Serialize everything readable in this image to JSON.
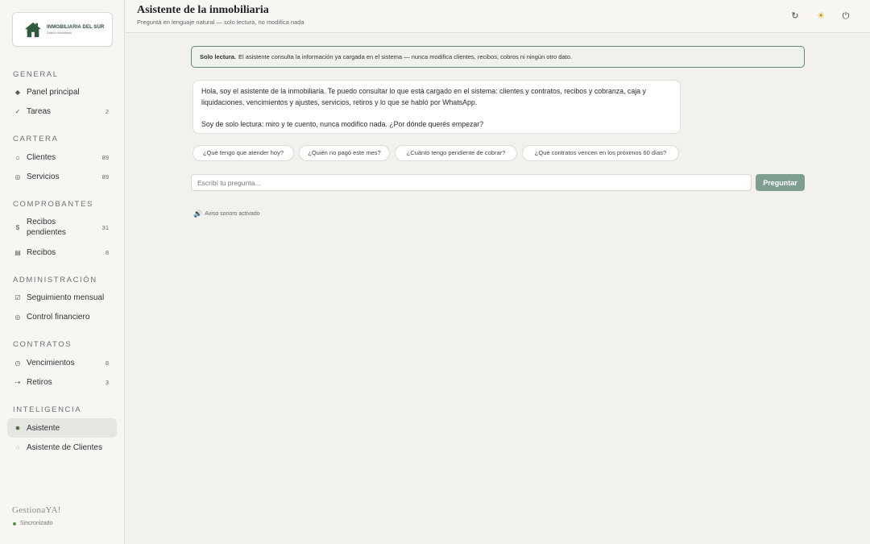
{
  "sidebar": {
    "logo_title": "INMOBILIARIA DEL SUR",
    "logo_subtitle": "Gestión inmobiliaria",
    "sections": {
      "general": "General",
      "cartera": "Cartera",
      "comprobantes": "Comprobantes",
      "administracion": "Administración",
      "contratos": "Contratos",
      "inteligencia": "Inteligencia"
    },
    "items": {
      "panel": {
        "label": "Panel principal",
        "icon": "◆"
      },
      "tareas": {
        "label": "Tareas",
        "icon": "✓",
        "count": "2"
      },
      "clientes": {
        "label": "Clientes",
        "icon": "⌂",
        "count": "89"
      },
      "servicios": {
        "label": "Servicios",
        "icon": "◎",
        "count": "89"
      },
      "recibos_pendientes": {
        "label": "Recibos pendientes",
        "icon": "$",
        "count": "31"
      },
      "recibos": {
        "label": "Recibos",
        "icon": "▤",
        "count": "8"
      },
      "seguimiento": {
        "label": "Seguimiento mensual",
        "icon": "☑"
      },
      "control": {
        "label": "Control financiero",
        "icon": "◎"
      },
      "vencimientos": {
        "label": "Vencimientos",
        "icon": "◷",
        "count": "8"
      },
      "retiros": {
        "label": "Retiros",
        "icon": "⇢",
        "count": "3"
      },
      "asistente": {
        "label": "Asistente",
        "icon": "✸"
      },
      "asistente_clientes": {
        "label": "Asistente de Clientes",
        "icon": "◌"
      }
    },
    "brand": "GestionaYA!",
    "sync_status": "Sincronizado",
    "sync_color": "#5a8f4e"
  },
  "header": {
    "title": "Asistente de la inmobiliaria",
    "subtitle": "Preguntá en lenguaje natural — solo lectura, no modifica nada",
    "refresh_icon": "↻",
    "theme_icon": "☀",
    "power_icon": "⏻"
  },
  "notice": {
    "strong": "Solo lectura.",
    "text": "El asistente consulta la información ya cargada en el sistema — nunca modifica clientes, recibos, cobros ni ningún otro dato."
  },
  "assistant_message": {
    "para1": "Hola, soy el asistente de la inmobiliaria. Te puedo consultar lo que está cargado en el sistema: clientes y contratos, recibos y cobranza, caja y liquidaciones, vencimientos y ajustes, servicios, retiros y lo que se habló por WhatsApp.",
    "para2": "Soy de solo lectura: miro y te cuento, nunca modifico nada. ¿Por dónde querés empezar?"
  },
  "suggestions": [
    "¿Qué tengo que atender hoy?",
    "¿Quién no pagó este mes?",
    "¿Cuánto tengo pendiente de cobrar?",
    "¿Qué contratos vencen en los próximos 60 días?"
  ],
  "input": {
    "placeholder": "Escribí tu pregunta...",
    "button_label": "Preguntar"
  },
  "sound": {
    "icon": "🔊",
    "label": "Aviso sonoro activado"
  },
  "colors": {
    "accent": "#5e8a73",
    "button": "#7e9f8f",
    "active_bg": "#e4e7e2"
  }
}
